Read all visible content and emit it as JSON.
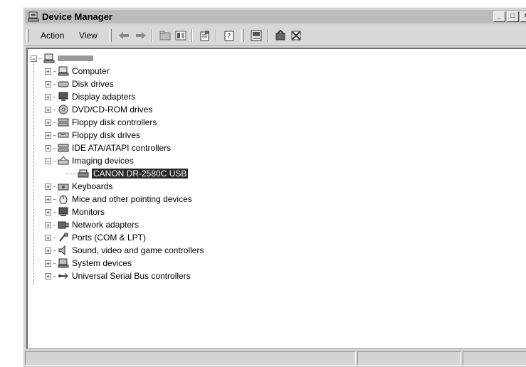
{
  "window": {
    "title": "Device Manager",
    "controls": [
      "_",
      "□",
      "×"
    ]
  },
  "menu": {
    "action": "Action",
    "view": "View"
  },
  "toolbar": {
    "buttons": [
      "back-icon",
      "forward-icon",
      "up-folder-icon",
      "show-hide-tree-icon",
      "properties-icon",
      "help-icon",
      "scan-hardware-icon",
      "update-driver-icon",
      "uninstall-icon"
    ]
  },
  "tree": {
    "root_label": "",
    "categories": [
      {
        "label": "Computer",
        "icon": "computer-icon",
        "expanded": false
      },
      {
        "label": "Disk drives",
        "icon": "disk-drive-icon",
        "expanded": false
      },
      {
        "label": "Display adapters",
        "icon": "display-icon",
        "expanded": false
      },
      {
        "label": "DVD/CD-ROM drives",
        "icon": "cdrom-icon",
        "expanded": false
      },
      {
        "label": "Floppy disk controllers",
        "icon": "floppy-controller-icon",
        "expanded": false
      },
      {
        "label": "Floppy disk drives",
        "icon": "floppy-drive-icon",
        "expanded": false
      },
      {
        "label": "IDE ATA/ATAPI controllers",
        "icon": "ide-controller-icon",
        "expanded": false
      },
      {
        "label": "Imaging devices",
        "icon": "imaging-device-icon",
        "expanded": true,
        "children": [
          {
            "label": "CANON DR-2580C USB",
            "icon": "scanner-icon",
            "selected": true
          }
        ]
      },
      {
        "label": "Keyboards",
        "icon": "keyboard-icon",
        "expanded": false
      },
      {
        "label": "Mice and other pointing devices",
        "icon": "mouse-icon",
        "expanded": false
      },
      {
        "label": "Monitors",
        "icon": "monitor-icon",
        "expanded": false
      },
      {
        "label": "Network adapters",
        "icon": "network-adapter-icon",
        "expanded": false
      },
      {
        "label": "Ports (COM & LPT)",
        "icon": "port-icon",
        "expanded": false
      },
      {
        "label": "Sound, video and game controllers",
        "icon": "sound-icon",
        "expanded": false
      },
      {
        "label": "System devices",
        "icon": "system-device-icon",
        "expanded": false
      },
      {
        "label": "Universal Serial Bus controllers",
        "icon": "usb-icon",
        "expanded": false
      }
    ]
  },
  "colors": {
    "selection": "#2a2a2a",
    "chrome": "#d4d4d4",
    "titlebar": "#bcbcbc"
  }
}
